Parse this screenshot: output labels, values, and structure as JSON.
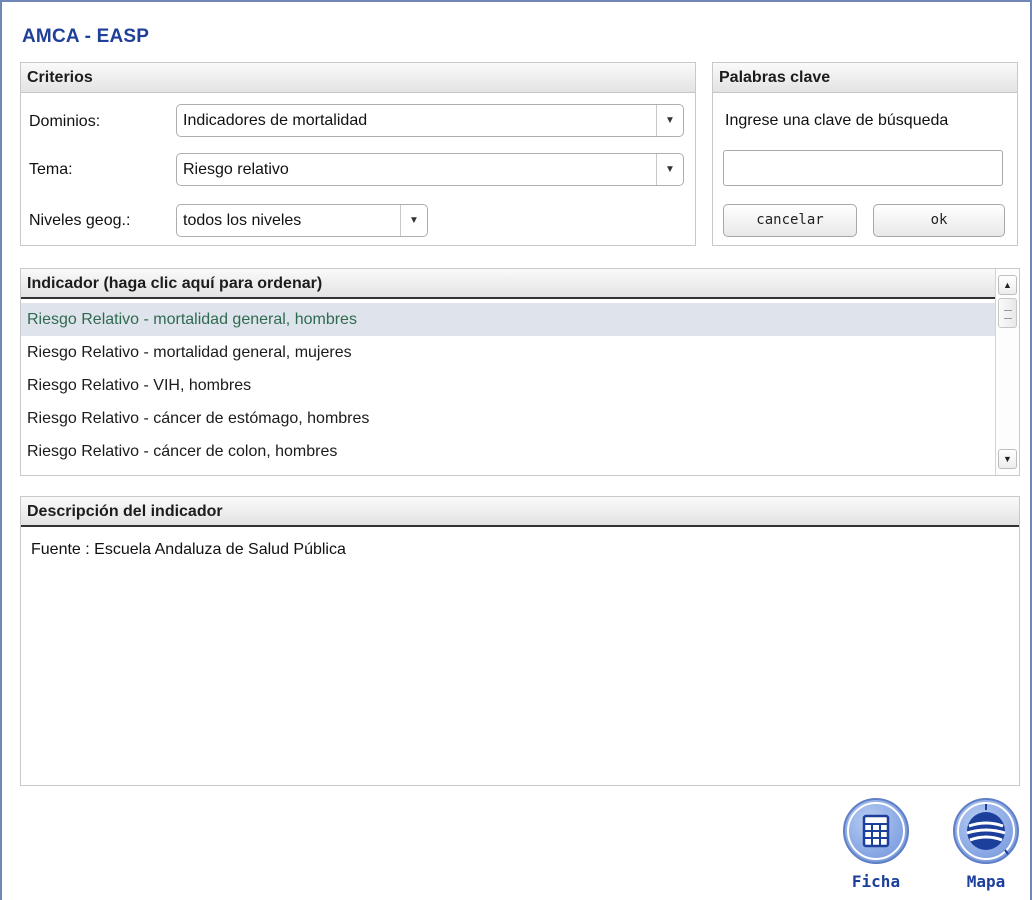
{
  "app_title": "AMCA - EASP",
  "criterios": {
    "header": "Criterios",
    "dominios_label": "Dominios:",
    "dominios_value": "Indicadores de mortalidad",
    "tema_label": "Tema:",
    "tema_value": "Riesgo relativo",
    "niveles_label": "Niveles geog.:",
    "niveles_value": "todos los niveles"
  },
  "palabras_clave": {
    "header": "Palabras clave",
    "prompt": "Ingrese una clave de búsqueda",
    "input_value": "",
    "cancel_label": "cancelar",
    "ok_label": "ok"
  },
  "indicador": {
    "header": "Indicador (haga clic aquí para ordenar)",
    "items": [
      "Riesgo Relativo - mortalidad general, hombres",
      "Riesgo Relativo - mortalidad general, mujeres",
      "Riesgo Relativo - VIH, hombres",
      "Riesgo Relativo - cáncer de estómago, hombres",
      "Riesgo Relativo - cáncer de colon, hombres"
    ],
    "selected_index": 0
  },
  "descripcion": {
    "header": "Descripción del indicador",
    "text": "Fuente : Escuela Andaluza de Salud Pública"
  },
  "actions": {
    "ficha_label": "Ficha",
    "ficha_icon": "table-icon",
    "mapa_label": "Mapa",
    "mapa_icon": "globe-icon"
  },
  "colors": {
    "title": "#1f3f98",
    "selected_row_bg": "#dfe3ec",
    "selected_row_text": "#2f6a4f",
    "action_circle": "#87a6e3"
  }
}
